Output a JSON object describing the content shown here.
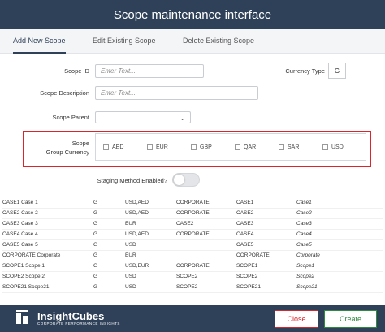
{
  "window": {
    "title": "Scope maintenance interface"
  },
  "tabs": [
    {
      "label": "Add New Scope"
    },
    {
      "label": "Edit Existing Scope"
    },
    {
      "label": "Delete Existing Scope"
    }
  ],
  "form": {
    "scope_id_label": "Scope ID",
    "scope_id_placeholder": "Enter Text...",
    "currency_type_label": "Currency Type",
    "currency_type_value": "G",
    "scope_description_label": "Scope Description",
    "scope_description_placeholder": "Enter Text...",
    "scope_parent_label": "Scope Parent",
    "group_currency_label_1": "Scope",
    "group_currency_label_2": "Group Currency",
    "currencies": [
      "AED",
      "EUR",
      "GBP",
      "QAR",
      "SAR",
      "USD"
    ],
    "staging_label": "Staging Method Enabled?"
  },
  "table": {
    "rows": [
      [
        "CASE1 Case 1",
        "G",
        "USD,AED",
        "CORPORATE",
        "CASE1",
        "Case1"
      ],
      [
        "CASE2 Case 2",
        "G",
        "USD,AED",
        "CORPORATE",
        "CASE2",
        "Case2"
      ],
      [
        "CASE3 Case 3",
        "G",
        "EUR",
        "CASE2",
        "CASE3",
        "Case3"
      ],
      [
        "CASE4 Case 4",
        "G",
        "USD,AED",
        "CORPORATE",
        "CASE4",
        "Case4"
      ],
      [
        "CASE5 Case 5",
        "G",
        "USD",
        "",
        "CASE5",
        "Case5"
      ],
      [
        "CORPORATE Corporate",
        "G",
        "EUR",
        "",
        "CORPORATE",
        "Corporate"
      ],
      [
        "SCOPE1 Scope 1",
        "G",
        "USD,EUR",
        "CORPORATE",
        "SCOPE1",
        "Scope1"
      ],
      [
        "SCOPE2 Scope 2",
        "G",
        "USD",
        "SCOPE2",
        "SCOPE2",
        "Scope2"
      ],
      [
        "SCOPE21 Scope21",
        "G",
        "USD",
        "SCOPE2",
        "SCOPE21",
        "Scope21"
      ]
    ]
  },
  "footer": {
    "logo_text": "InsightCubes",
    "logo_sub": "CORPORATE PERFORMANCE INSIGHTS",
    "close_label": "Close",
    "create_label": "Create"
  },
  "colors": {
    "header": "#2f4159",
    "highlight": "#d9262c",
    "create": "#2e8b3e"
  }
}
